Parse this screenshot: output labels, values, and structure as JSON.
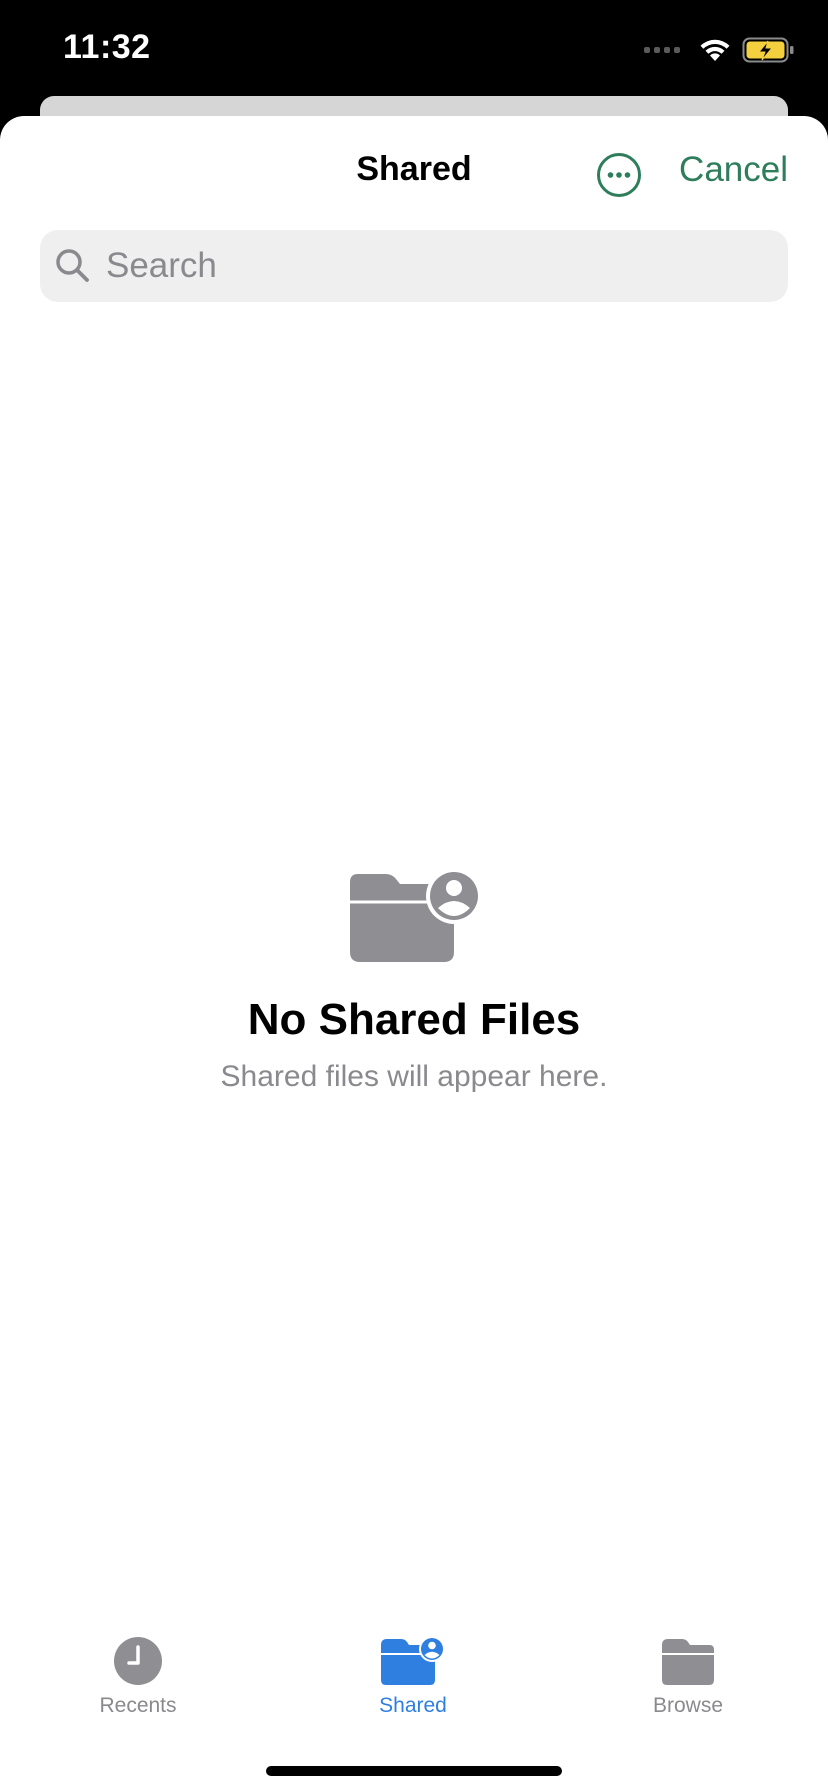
{
  "status_bar": {
    "time": "11:32",
    "icons": [
      "cellular-signal-icon",
      "wifi-icon",
      "battery-charging-icon"
    ]
  },
  "nav": {
    "title": "Shared",
    "more_icon": "ellipsis-circle-icon",
    "cancel_label": "Cancel"
  },
  "search": {
    "placeholder": "Search",
    "value": ""
  },
  "empty_state": {
    "icon": "shared-folder-icon",
    "title": "No Shared Files",
    "subtitle": "Shared files will appear here."
  },
  "tab_bar": {
    "tabs": [
      {
        "label": "Recents",
        "icon": "clock-icon",
        "active": false
      },
      {
        "label": "Shared",
        "icon": "shared-folder-icon",
        "active": true
      },
      {
        "label": "Browse",
        "icon": "folder-icon",
        "active": false
      }
    ]
  },
  "colors": {
    "accent_green": "#2e7d5b",
    "active_blue": "#2f7fe0",
    "inactive_gray": "#8a8a8e",
    "icon_gray": "#8e8e93"
  }
}
